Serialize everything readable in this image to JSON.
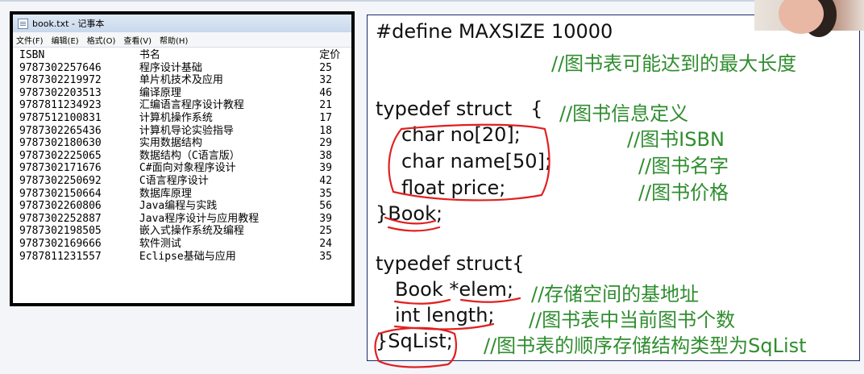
{
  "notepad": {
    "title": "book.txt - 记事本",
    "menu": [
      "文件(F)",
      "编辑(E)",
      "格式(O)",
      "查看(V)",
      "帮助(H)"
    ],
    "columns": [
      "ISBN",
      "书名",
      "定价"
    ],
    "rows": [
      [
        "9787302257646",
        "程序设计基础",
        "25"
      ],
      [
        "9787302219972",
        "单片机技术及应用",
        "32"
      ],
      [
        "9787302203513",
        "编译原理",
        "46"
      ],
      [
        "9787811234923",
        "汇编语言程序设计教程",
        "21"
      ],
      [
        "9787512100831",
        "计算机操作系统",
        "17"
      ],
      [
        "9787302265436",
        "计算机导论实验指导",
        "18"
      ],
      [
        "9787302180630",
        "实用数据结构",
        "29"
      ],
      [
        "9787302225065",
        "数据结构（C语言版）",
        "38"
      ],
      [
        "9787302171676",
        "C#面向对象程序设计",
        "39"
      ],
      [
        "9787302250692",
        "C语言程序设计",
        "42"
      ],
      [
        "9787302150664",
        "数据库原理",
        "35"
      ],
      [
        "9787302260806",
        "Java编程与实践",
        "56"
      ],
      [
        "9787302252887",
        "Java程序设计与应用教程",
        "39"
      ],
      [
        "9787302198505",
        "嵌入式操作系统及编程",
        "25"
      ],
      [
        "9787302169666",
        "软件测试",
        "24"
      ],
      [
        "9787811231557",
        "Eclipse基础与应用",
        "35"
      ]
    ]
  },
  "slide": {
    "define_line": "#define MAXSIZE 10000",
    "define_comment": "//图书表可能达到的最大长度",
    "book_open": "typedef struct   {",
    "book_open_comment": "//图书信息定义",
    "f1_code": "char no[20];",
    "f1_comment": "//图书ISBN",
    "f2_code": "char name[50];",
    "f2_comment": "//图书名字",
    "f3_code": "float price;",
    "f3_comment": "//图书价格",
    "book_close": "}Book;",
    "sq_open": "typedef struct{",
    "s1_code": "Book *elem;",
    "s1_comment": "//存储空间的基地址",
    "s2_code": "int length;",
    "s2_comment": "//图书表中当前图书个数",
    "sq_close": "}SqList;",
    "sq_close_comment": "//图书表的顺序存储结构类型为SqList"
  },
  "colors": {
    "comment": "#2f8d2f",
    "annotation": "#e02020",
    "border": "#1b2a6e"
  }
}
